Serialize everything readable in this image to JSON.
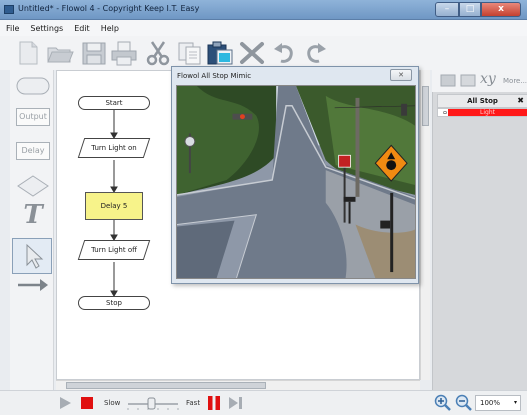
{
  "window": {
    "title": "Untitled* - Flowol 4 - Copyright Keep I.T. Easy",
    "min_glyph": "–",
    "max_glyph": "□",
    "close_glyph": "x"
  },
  "menu": [
    "File",
    "Settings",
    "Edit",
    "Help"
  ],
  "toolbar": {
    "icons": [
      "new-file-icon",
      "open-folder-icon",
      "save-icon",
      "print-icon",
      "cut-icon",
      "copy-icon",
      "paste-icon",
      "delete-icon",
      "undo-icon",
      "redo-icon"
    ]
  },
  "palette": {
    "output_label": "Output",
    "delay_label": "Delay",
    "text_glyph": "T",
    "items": [
      "start-stop-shape-icon",
      "output-shape",
      "delay-shape",
      "decision-shape-icon",
      "text-tool-icon",
      "pointer-tool-icon",
      "arrow-connector-icon"
    ]
  },
  "flowchart": {
    "start": "Start",
    "turn_on": "Turn Light on",
    "delay": "Delay 5",
    "turn_off": "Turn Light off",
    "stop": "Stop"
  },
  "mimic": {
    "title": "Flowol All Stop Mimic",
    "close_glyph": "✕"
  },
  "right_panel": {
    "xy_label": "xy",
    "more_label": "More...",
    "header": "All Stop",
    "pin_glyph": "✖",
    "row_index": "0",
    "row_value": "Light",
    "row_color": "#ff1818"
  },
  "bottom": {
    "slow_label": "Slow",
    "fast_label": "Fast",
    "zoom_value": "100%",
    "zoom_dropdown": "▾"
  },
  "colors": {
    "delay_fill": "#f7f38a",
    "stop_button": "#e01010",
    "pause_button": "#e01010"
  }
}
